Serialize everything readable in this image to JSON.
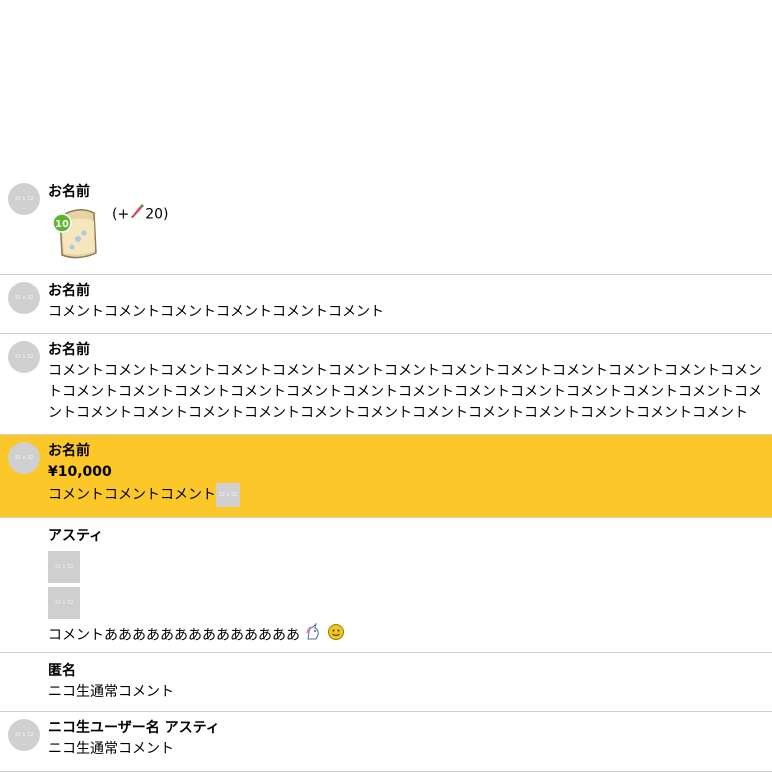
{
  "avatar_placeholder": "32 x 32",
  "thumb_placeholder": "32 x 32",
  "rows": [
    {
      "name": "お名前",
      "gift": {
        "level_badge": "10",
        "bonus_open": "(+",
        "bonus_icon": "pen-icon",
        "bonus_value": "20)"
      }
    },
    {
      "name": "お名前",
      "comment": "コメントコメントコメントコメントコメントコメント"
    },
    {
      "name": "お名前",
      "comment": "コメントコメントコメントコメントコメントコメントコメントコメントコメントコメントコメントコメントコメントコメントコメントコメントコメントコメントコメントコメントコメントコメントコメントコメントコメントコメントコメントコメントコメントコメントコメントコメントコメントコメントコメントコメントコメントコメント"
    },
    {
      "name": "お名前",
      "amount": "¥10,000",
      "comment": "コメントコメントコメント",
      "highlight_color": "#fcc728"
    },
    {
      "name": "アスティ",
      "comment": "コメントああああああああああああああ",
      "emoji": [
        "unicorn-icon",
        "smiley-icon"
      ]
    },
    {
      "name": "匿名",
      "comment": "ニコ生通常コメント"
    },
    {
      "name": "ニコ生ユーザー名 アスティ",
      "comment": "ニコ生通常コメント"
    }
  ]
}
